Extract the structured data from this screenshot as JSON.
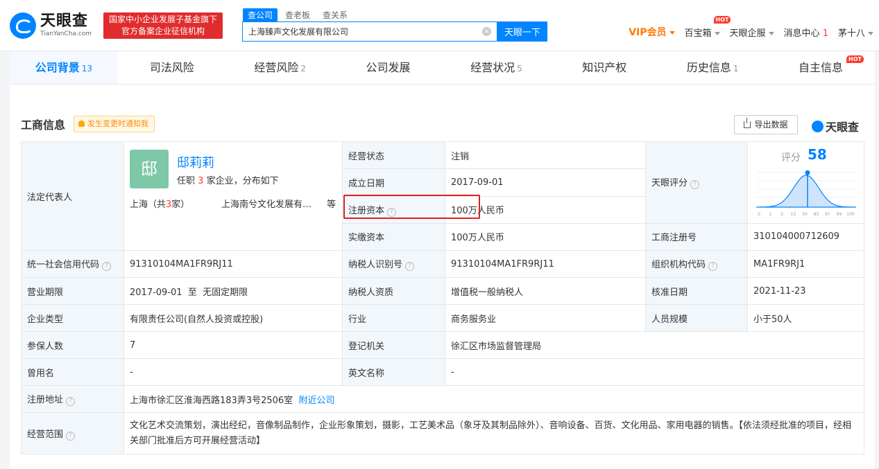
{
  "header": {
    "logo_cn": "天眼查",
    "logo_en": "TianYanCha.com",
    "banner_line1": "国家中小企业发展子基金旗下",
    "banner_line2": "官方备案企业征信机构",
    "search_tabs": [
      "查公司",
      "查老板",
      "查关系"
    ],
    "search_value": "上海臻声文化发展有限公司",
    "search_button": "天眼一下",
    "nav": {
      "vip": "VIP会员",
      "treasure": "百宝箱",
      "hot_badge": "HOT",
      "enterprise": "天眼企服",
      "messages": "消息中心",
      "messages_count": "1",
      "user": "茅十八"
    }
  },
  "tabs": [
    {
      "label": "公司背景",
      "count": "13"
    },
    {
      "label": "司法风险",
      "count": ""
    },
    {
      "label": "经营风险",
      "count": "2"
    },
    {
      "label": "公司发展",
      "count": ""
    },
    {
      "label": "经营状况",
      "count": "5"
    },
    {
      "label": "知识产权",
      "count": ""
    },
    {
      "label": "历史信息",
      "count": "1"
    },
    {
      "label": "自主信息",
      "count": "",
      "badge": "HOT"
    }
  ],
  "section": {
    "title": "工商信息",
    "notify": "发生变更时通知我",
    "export": "导出数据",
    "brand": "天眼查"
  },
  "rep": {
    "label": "法定代表人",
    "avatar": "邸",
    "name": "邸莉莉",
    "jobs_prefix": "任职",
    "jobs_count": "3",
    "jobs_suffix": "家企业，分布如下",
    "region_prefix": "上海（共",
    "region_count": "3",
    "region_suffix": "家）",
    "company": "上海南兮文化发展有…",
    "etc": "等"
  },
  "fields": {
    "status_label": "经营状态",
    "status": "注销",
    "founded_label": "成立日期",
    "founded": "2017-09-01",
    "capital_label": "注册资本",
    "capital": "100万人民币",
    "paid_label": "实缴资本",
    "paid": "100万人民币",
    "score_label": "天眼评分",
    "reg_no_label": "工商注册号",
    "reg_no": "310104000712609",
    "credit_label": "统一社会信用代码",
    "credit": "91310104MA1FR9RJ11",
    "taxid_label": "纳税人识别号",
    "taxid": "91310104MA1FR9RJ11",
    "org_label": "组织机构代码",
    "org": "MA1FR9RJ1",
    "term_label": "营业期限",
    "term": "2017-09-01  至  无固定期限",
    "tax_qual_label": "纳税人资质",
    "tax_qual": "增值税一般纳税人",
    "approve_label": "核准日期",
    "approve": "2021-11-23",
    "type_label": "企业类型",
    "type": "有限责任公司(自然人投资或控股)",
    "industry_label": "行业",
    "industry": "商务服务业",
    "staff_label": "人员规模",
    "staff": "小于50人",
    "insured_label": "参保人数",
    "insured": "7",
    "authority_label": "登记机关",
    "authority": "徐汇区市场监督管理局",
    "former_label": "曾用名",
    "former": "-",
    "en_label": "英文名称",
    "en": "-",
    "addr_label": "注册地址",
    "addr": "上海市徐汇区淮海西路183弄3号2506室",
    "nearby": "附近公司",
    "scope_label": "经营范围",
    "scope": "文化艺术交流策划，演出经纪，音像制品制作，企业形象策划，摄影，工艺美术品（象牙及其制品除外）、音响设备、百货、文化用品、家用电器的销售。【依法须经批准的项目，经相关部门批准后方可开展经营活动】"
  },
  "score": {
    "label": "评分",
    "value": "58",
    "value_num": 58,
    "axis": [
      "0",
      "1",
      "3",
      "15",
      "50",
      "85",
      "97",
      "99",
      "100"
    ],
    "accent": "#0084ff"
  },
  "colors": {
    "brand": "#0084ff",
    "alert": "#e02020",
    "vip": "#ff7a00"
  }
}
